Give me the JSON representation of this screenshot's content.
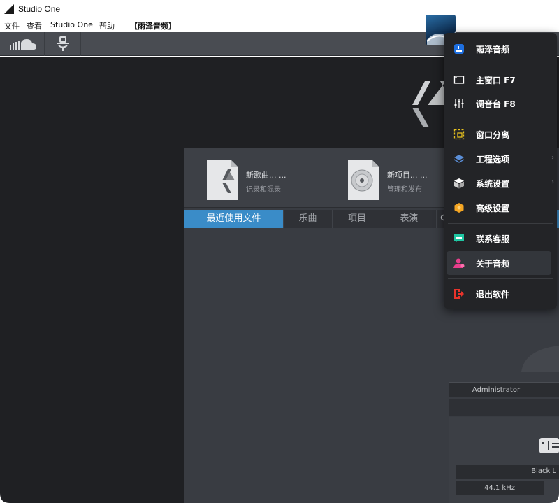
{
  "window": {
    "title": "Studio One"
  },
  "menubar": {
    "items": [
      "文件",
      "查看",
      "Studio One",
      "帮助"
    ],
    "tag": "【雨泽音频】"
  },
  "start": {
    "new_song": {
      "title": "新歌曲... ...",
      "sub": "记录和混录"
    },
    "new_project": {
      "title": "新项目... ...",
      "sub": "管理和发布"
    },
    "tabs": [
      "最近使用文件",
      "乐曲",
      "项目",
      "表演"
    ]
  },
  "right": {
    "user": "Administrator",
    "device": "Black L",
    "rate": "44.1 kHz"
  },
  "menu": {
    "items": [
      {
        "label": "雨泽音频",
        "icon": "brand-logo-icon"
      },
      {
        "label": "主窗口  F7",
        "icon": "window-icon"
      },
      {
        "label": "调音台  F8",
        "icon": "mixer-sliders-icon"
      },
      {
        "label": "窗口分离",
        "icon": "detach-window-icon"
      },
      {
        "label": "工程选项",
        "icon": "layers-icon",
        "submenu": true
      },
      {
        "label": "系统设置",
        "icon": "cube-icon",
        "submenu": true
      },
      {
        "label": "高级设置",
        "icon": "hexagon-icon"
      },
      {
        "label": "联系客服",
        "icon": "chat-icon"
      },
      {
        "label": "关于音频",
        "icon": "user-icon"
      },
      {
        "label": "退出软件",
        "icon": "exit-icon"
      }
    ],
    "submenu_glyph": "›"
  },
  "colors": {
    "accent_blue": "#3a8cc8",
    "detach_yellow": "#e8c21e",
    "hex_orange": "#f5a623",
    "chat_teal": "#1fc7a3",
    "user_pink": "#e83e8c",
    "exit_red": "#e8332b"
  }
}
